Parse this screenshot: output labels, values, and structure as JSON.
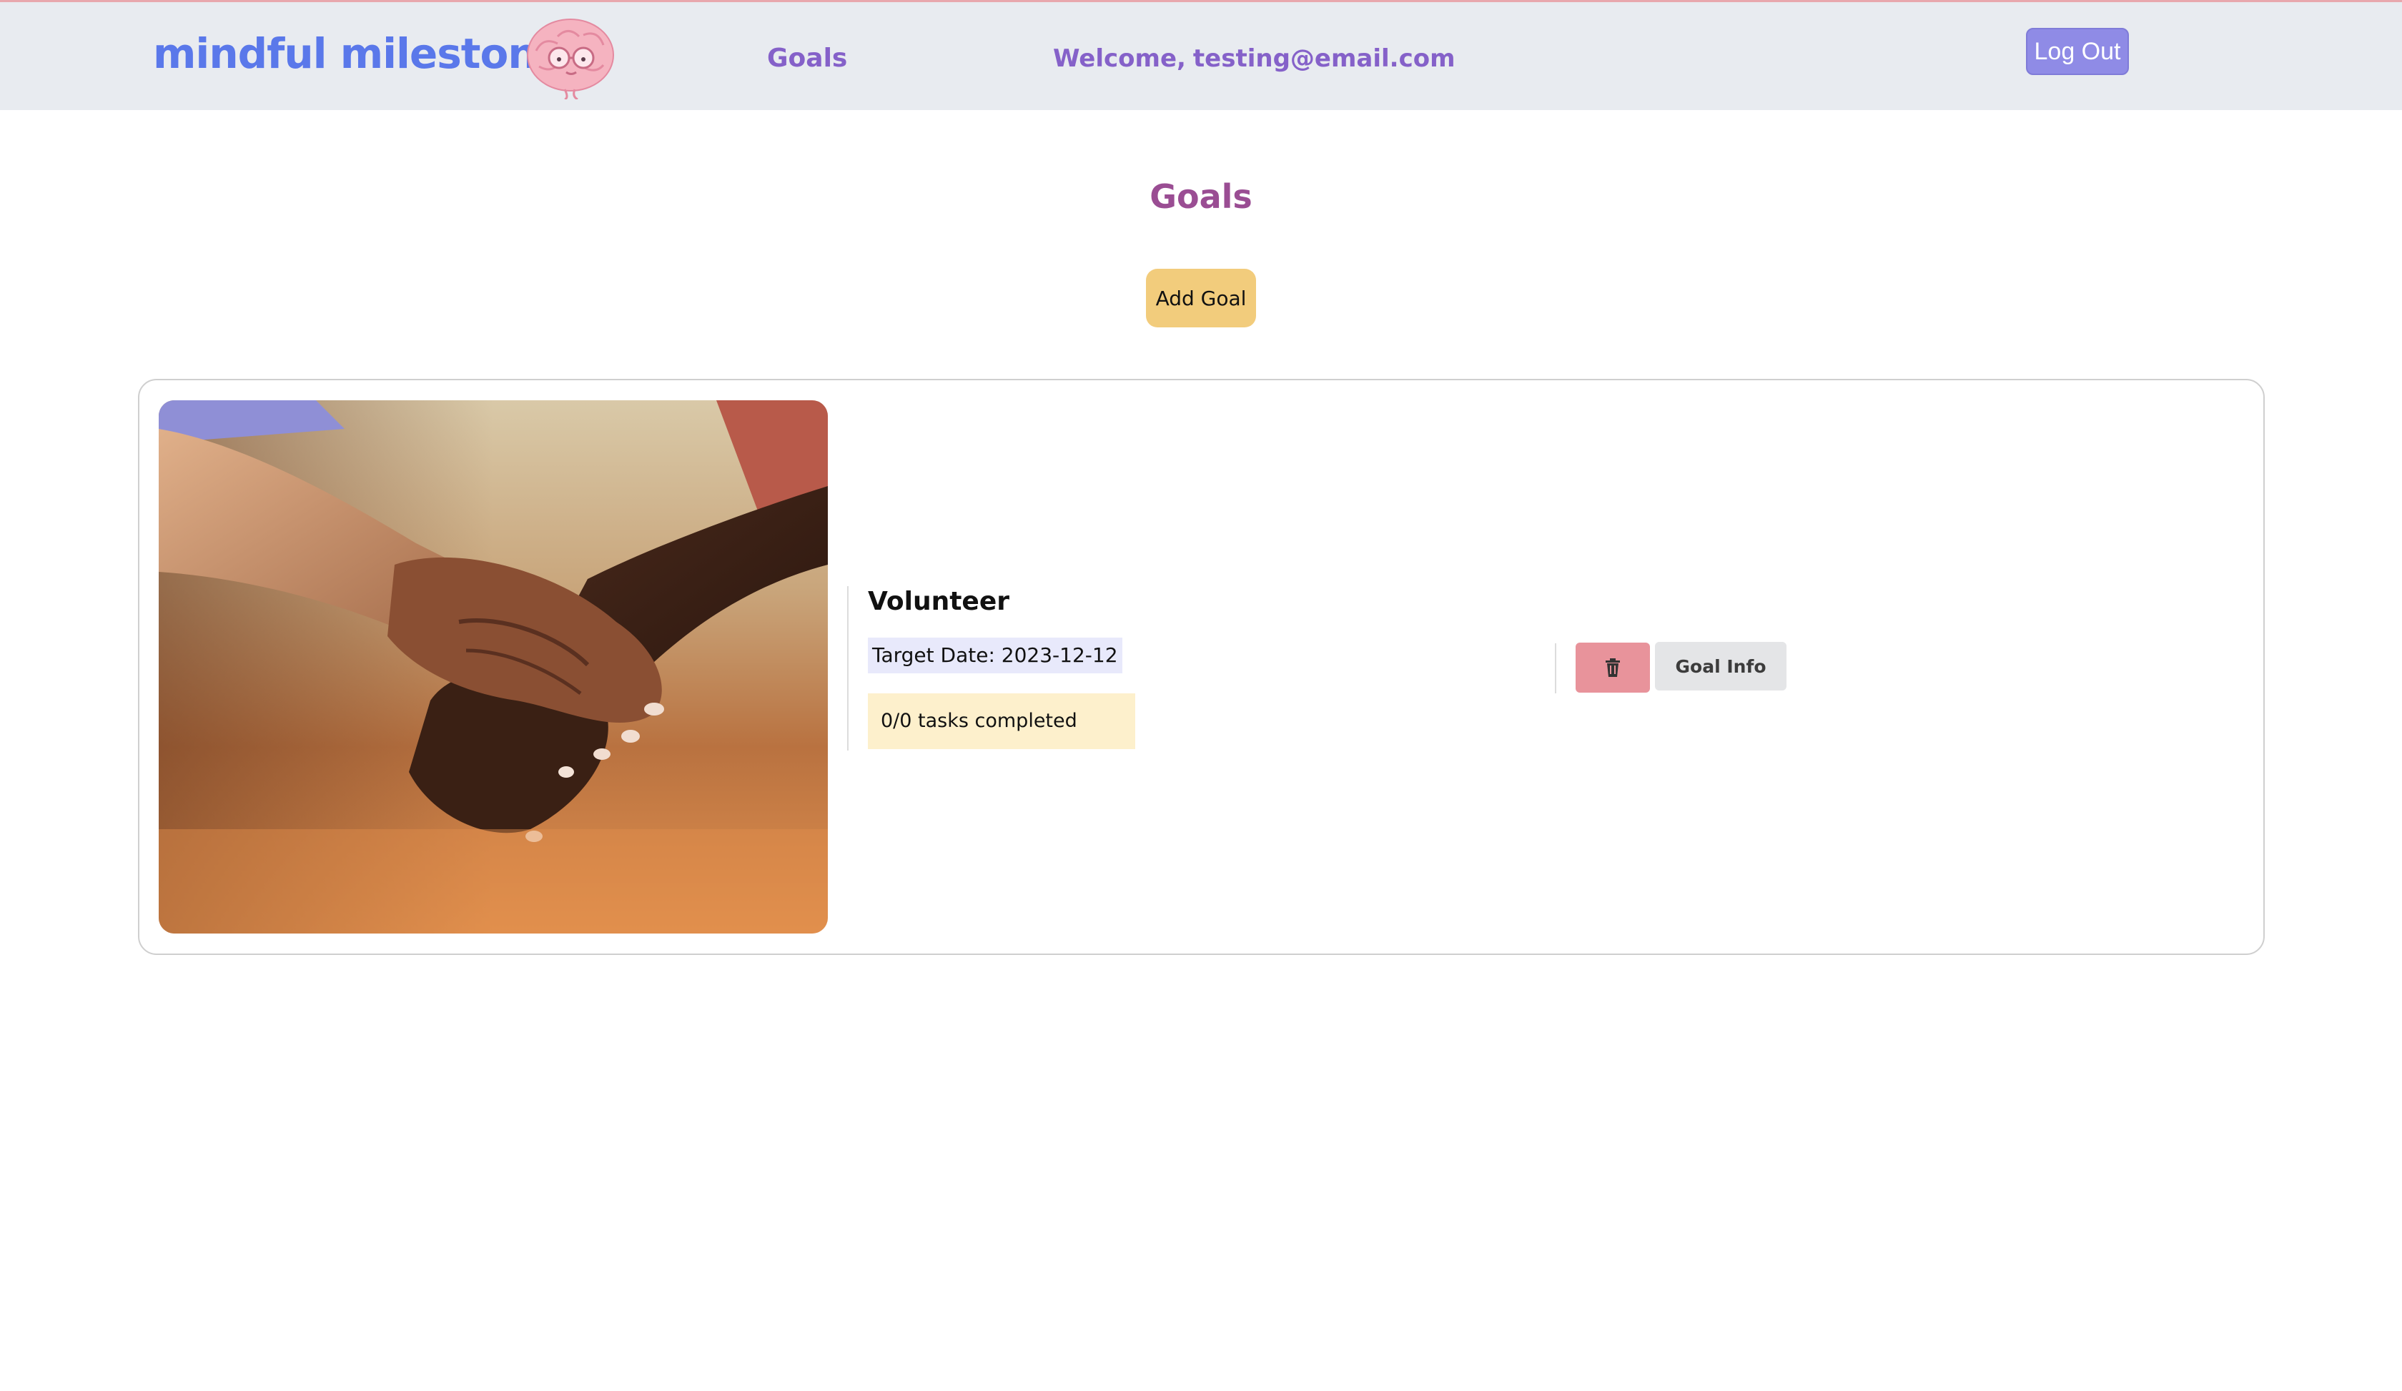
{
  "header": {
    "logo_text": "mindful milestones",
    "logo_icon": "brain-with-glasses-icon",
    "nav_goals": "Goals",
    "welcome_prefix": "Welcome,",
    "user_email": "testing@email.com",
    "logout_label": "Log Out"
  },
  "main": {
    "title": "Goals",
    "add_goal_label": "Add Goal",
    "goals": [
      {
        "image": "holding-hands-photo",
        "title": "Volunteer",
        "target_date": "Target Date: 2023-12-12",
        "tasks": "0/0 tasks completed",
        "delete_icon": "trash-icon",
        "info_label": "Goal Info"
      }
    ]
  },
  "colors": {
    "header_bg": "#e8ebf0",
    "logo": "#5a78ea",
    "nav": "#8561c9",
    "logout": "#8f8be6",
    "title": "#9a4d93",
    "add_goal": "#f2cc7c",
    "delete": "#e8939b",
    "date_bg": "#e8e9fb",
    "tasks_bg": "#fdf0cc"
  }
}
